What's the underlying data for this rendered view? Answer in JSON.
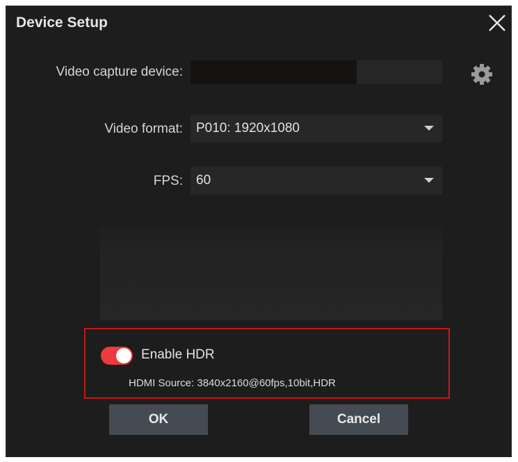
{
  "dialog": {
    "title": "Device Setup"
  },
  "capture": {
    "label": "Video capture device:"
  },
  "format": {
    "label": "Video format:",
    "value": "P010: 1920x1080"
  },
  "fps": {
    "label": "FPS:",
    "value": "60"
  },
  "hdr": {
    "label": "Enable HDR",
    "enabled": true,
    "source": "HDMI Source: 3840x2160@60fps,10bit,HDR"
  },
  "buttons": {
    "ok": "OK",
    "cancel": "Cancel"
  },
  "icons": {
    "close": "close-icon",
    "settings": "gear-icon",
    "add": "plus-icon",
    "dropdown": "chevron-down-icon"
  },
  "colors": {
    "background": "#1d1d1d",
    "field": "#272727",
    "toggle_on": "#ee3a3f",
    "highlight_border": "#c9161b",
    "button": "#454b53"
  }
}
